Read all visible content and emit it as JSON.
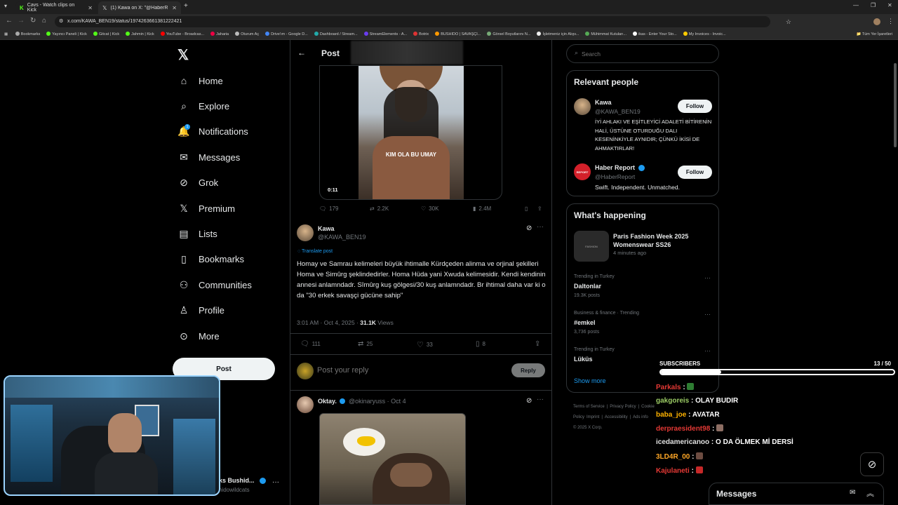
{
  "browser": {
    "tabs": [
      {
        "title": "Cavs - Watch clips on Kick"
      },
      {
        "title": "(1) Kawa on X: \"@HaberReport"
      }
    ],
    "url": "x.com/KAWA_BEN19/status/1974263661381222421",
    "bookmarks": [
      "Bookmarks",
      "Yayıncı Paneli | Kick",
      "Gitcat | Kick",
      "Jahmin | Kick",
      "YouTube - Broadcas...",
      "Jaharia",
      "Oturum Aç",
      "Drive'ım - Google D...",
      "Dashboard / Stream...",
      "StreamElements - A...",
      "Botrix",
      "BUSHIDO | SAVAŞÇI...",
      "Görsel Boyutlarını N...",
      "İşletmeniz için Alışv...",
      "Mühimmat Kutuları...",
      "ikas - Enter Your Sto...",
      "My Invoices - Invoic..."
    ],
    "all_bookmarks": "Tüm Yer İşaretleri"
  },
  "nav": {
    "items": [
      {
        "label": "Home",
        "icon": "home-icon"
      },
      {
        "label": "Explore",
        "icon": "search-icon"
      },
      {
        "label": "Notifications",
        "icon": "bell-icon",
        "badge": "1"
      },
      {
        "label": "Messages",
        "icon": "mail-icon"
      },
      {
        "label": "Grok",
        "icon": "grok-icon"
      },
      {
        "label": "Premium",
        "icon": "x-logo-icon"
      },
      {
        "label": "Lists",
        "icon": "list-icon"
      },
      {
        "label": "Bookmarks",
        "icon": "bookmark-icon"
      },
      {
        "label": "Communities",
        "icon": "people-icon"
      },
      {
        "label": "Profile",
        "icon": "person-icon"
      },
      {
        "label": "More",
        "icon": "more-circle-icon"
      }
    ],
    "post_button": "Post",
    "account_name": "ks Bushid...",
    "account_handle": "hidowildcats"
  },
  "header": {
    "title": "Post"
  },
  "video": {
    "caption": "KIM OLA BU UMAY",
    "time": "0:11",
    "stats": {
      "replies": "179",
      "reposts": "2.2K",
      "likes": "30K",
      "views": "2.4M"
    }
  },
  "tweet": {
    "name": "Kawa",
    "handle": "@KAWA_BEN19",
    "translate": "Translate post",
    "text": "Homay ve Samrau kelimeleri büyük ihtimalle Kürdçeden alinma ve orjinal şekilleri Homa ve Simûrg şeklindedirler. Homa Hüda yani Xwuda kelimesidir. Kendi kendinin annesi anlamndadr. Sîmûrg  kuş gölgesi/30 kuş anlamndadr. Br ihtimal daha var ki o da \"30 erkek savaşçi gücüne sahip\"",
    "time": "3:01 AM · Oct 4, 2025 · ",
    "views_count": "31.1K",
    "views_label": " Views",
    "stats": {
      "replies": "111",
      "reposts": "25",
      "likes": "33",
      "bookmarks": "8"
    }
  },
  "reply_box": {
    "placeholder": "Post your reply",
    "button": "Reply"
  },
  "reply": {
    "name": "Oktay.",
    "handle": "@okinaryuss · Oct 4"
  },
  "search": {
    "placeholder": "Search"
  },
  "relevant": {
    "title": "Relevant people",
    "people": [
      {
        "name": "Kawa",
        "handle": "@KAWA_BEN19",
        "bio": "İYİ AHLAKI VE EŞİTLEYİCİ ADALETİ BİTİRENİN HALİ, ÜSTÜNE OTURDUĞU DALI KESENİNKİYLE AYNIDIR; ÇÜNKÜ İKİSİ DE AHMAKTIRLAR!",
        "follow": "Follow"
      },
      {
        "name": "Haber Report",
        "handle": "@HaberReport",
        "bio": "Swift. Independent. Unmatched.",
        "follow": "Follow"
      }
    ]
  },
  "happening": {
    "title": "What's happening",
    "event": {
      "title": "Paris Fashion Week 2025 Womenswear SS26",
      "time": "4 minutes ago",
      "thumb": "FASHION"
    },
    "trends": [
      {
        "meta": "Trending in Turkey",
        "name": "Daltonlar",
        "posts": "19.3K posts"
      },
      {
        "meta": "Business & finance · Trending",
        "name": "#emkel",
        "posts": "3,736 posts"
      },
      {
        "meta": "Trending in Turkey",
        "name": "Lüküs",
        "posts": ""
      }
    ],
    "show_more": "Show more"
  },
  "footer": {
    "links": [
      "Terms of Service",
      "|",
      "Privacy Policy",
      "|",
      "Cookie Policy",
      "Imprint",
      "|",
      "Accessibility",
      "|",
      "Ads info"
    ],
    "copyright": "© 2025 X Corp."
  },
  "overlay": {
    "subs_label": "SUBSCRIBERS",
    "subs_count": "13",
    "subs_total": "/ 50",
    "subs_progress": 0.26,
    "chat": [
      {
        "user": "Parkals",
        "msg": "",
        "color": "#e53935"
      },
      {
        "user": "gakgoreis",
        "msg": "OLAY BUDIR",
        "color": "#9ccc65"
      },
      {
        "user": "baba_joe",
        "msg": "AVATAR",
        "color": "#ffb300"
      },
      {
        "user": "derpraesident98",
        "msg": "",
        "color": "#e53935"
      },
      {
        "user": "icedamericanoo",
        "msg": "O DA ÖLMEK Mİ DERSİ",
        "color": "#e0e0e0"
      },
      {
        "user": "3LD4R_00",
        "msg": "",
        "color": "#ffa726"
      },
      {
        "user": "Kajulaneti",
        "msg": "",
        "color": "#e53935"
      }
    ]
  },
  "messages_drawer": {
    "title": "Messages"
  }
}
